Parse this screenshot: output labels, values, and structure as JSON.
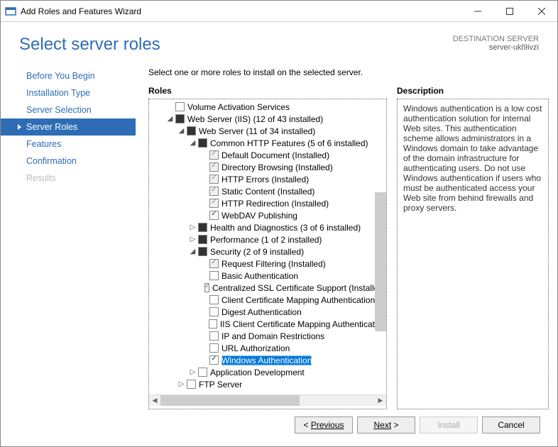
{
  "titlebar": {
    "title": "Add Roles and Features Wizard"
  },
  "header": {
    "title": "Select server roles",
    "dest_label": "DESTINATION SERVER",
    "dest_server": "server-ukl9ivzi"
  },
  "nav": [
    {
      "id": "before",
      "label": "Before You Begin",
      "active": false,
      "disabled": false
    },
    {
      "id": "instType",
      "label": "Installation Type",
      "active": false,
      "disabled": false
    },
    {
      "id": "serverSel",
      "label": "Server Selection",
      "active": false,
      "disabled": false
    },
    {
      "id": "serverRoles",
      "label": "Server Roles",
      "active": true,
      "disabled": false
    },
    {
      "id": "features",
      "label": "Features",
      "active": false,
      "disabled": false
    },
    {
      "id": "confirm",
      "label": "Confirmation",
      "active": false,
      "disabled": false
    },
    {
      "id": "results",
      "label": "Results",
      "active": false,
      "disabled": true
    }
  ],
  "instruction": "Select one or more roles to install on the selected server.",
  "roles_label": "Roles",
  "desc_label": "Description",
  "description": "Windows authentication is a low cost authentication solution for internal Web sites. This authentication scheme allows administrators in a Windows domain to take advantage of the domain infrastructure for authenticating users. Do not use Windows authentication if users who must be authenticated access your Web site from behind firewalls and proxy servers.",
  "tree": {
    "volAct": {
      "label": "Volume Activation Services",
      "state": "unchecked"
    },
    "iis": {
      "label": "Web Server (IIS) (12 of 43 installed)",
      "state": "partial"
    },
    "webServer": {
      "label": "Web Server (11 of 34 installed)",
      "state": "partial"
    },
    "commonHttp": {
      "label": "Common HTTP Features (5 of 6 installed)",
      "state": "partial"
    },
    "defaultDoc": {
      "label": "Default Document (Installed)",
      "state": "gray"
    },
    "dirBrowse": {
      "label": "Directory Browsing (Installed)",
      "state": "gray"
    },
    "httpErrors": {
      "label": "HTTP Errors (Installed)",
      "state": "gray"
    },
    "staticContent": {
      "label": "Static Content (Installed)",
      "state": "gray"
    },
    "httpRedirect": {
      "label": "HTTP Redirection (Installed)",
      "state": "gray"
    },
    "webdav": {
      "label": "WebDAV Publishing",
      "state": "checked"
    },
    "health": {
      "label": "Health and Diagnostics (3 of 6 installed)",
      "state": "partial"
    },
    "perf": {
      "label": "Performance (1 of 2 installed)",
      "state": "partial"
    },
    "security": {
      "label": "Security (2 of 9 installed)",
      "state": "partial"
    },
    "reqFilter": {
      "label": "Request Filtering (Installed)",
      "state": "gray"
    },
    "basicAuth": {
      "label": "Basic Authentication",
      "state": "unchecked"
    },
    "centSsl": {
      "label": "Centralized SSL Certificate Support (Installed)",
      "state": "gray"
    },
    "clientCert": {
      "label": "Client Certificate Mapping Authentication",
      "state": "unchecked"
    },
    "digest": {
      "label": "Digest Authentication",
      "state": "unchecked"
    },
    "iisClientCert": {
      "label": "IIS Client Certificate Mapping Authentication",
      "state": "unchecked"
    },
    "ipDomain": {
      "label": "IP and Domain Restrictions",
      "state": "unchecked"
    },
    "urlAuth": {
      "label": "URL Authorization",
      "state": "unchecked"
    },
    "winAuth": {
      "label": "Windows Authentication",
      "state": "checked",
      "selected": true
    },
    "appDev": {
      "label": "Application Development",
      "state": "unchecked"
    },
    "ftp": {
      "label": "FTP Server",
      "state": "unchecked"
    }
  },
  "buttons": {
    "previous": "Previous",
    "next": "Next",
    "install": "Install",
    "cancel": "Cancel"
  }
}
